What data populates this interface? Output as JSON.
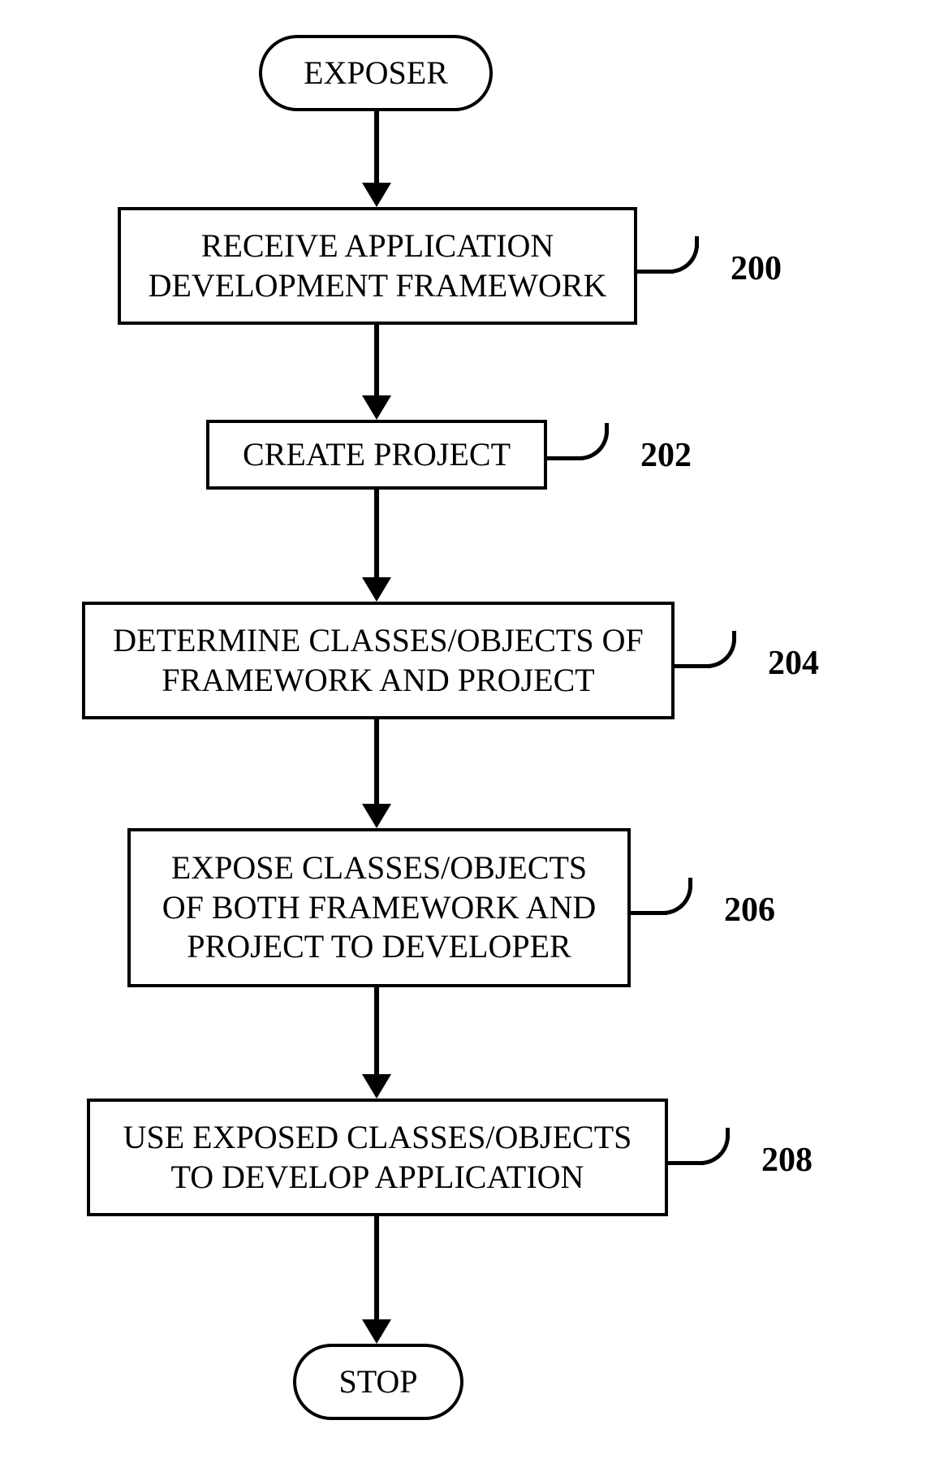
{
  "chart_data": {
    "type": "flowchart",
    "direction": "top-to-bottom",
    "nodes": [
      {
        "id": "start",
        "shape": "terminator",
        "text": "EXPOSER"
      },
      {
        "id": "n200",
        "shape": "process",
        "text": "RECEIVE APPLICATION DEVELOPMENT FRAMEWORK",
        "ref": "200"
      },
      {
        "id": "n202",
        "shape": "process",
        "text": "CREATE PROJECT",
        "ref": "202"
      },
      {
        "id": "n204",
        "shape": "process",
        "text": "DETERMINE CLASSES/OBJECTS OF FRAMEWORK AND PROJECT",
        "ref": "204"
      },
      {
        "id": "n206",
        "shape": "process",
        "text": "EXPOSE CLASSES/OBJECTS OF BOTH FRAMEWORK AND PROJECT TO DEVELOPER",
        "ref": "206"
      },
      {
        "id": "n208",
        "shape": "process",
        "text": "USE EXPOSED CLASSES/OBJECTS TO DEVELOP APPLICATION",
        "ref": "208"
      },
      {
        "id": "stop",
        "shape": "terminator",
        "text": "STOP"
      }
    ],
    "edges": [
      [
        "start",
        "n200"
      ],
      [
        "n200",
        "n202"
      ],
      [
        "n202",
        "n204"
      ],
      [
        "n204",
        "n206"
      ],
      [
        "n206",
        "n208"
      ],
      [
        "n208",
        "stop"
      ]
    ]
  },
  "start": {
    "label": "EXPOSER"
  },
  "stop": {
    "label": "STOP"
  },
  "step200": {
    "line1": "RECEIVE APPLICATION",
    "line2": "DEVELOPMENT FRAMEWORK",
    "ref": "200"
  },
  "step202": {
    "line1": "CREATE PROJECT",
    "ref": "202"
  },
  "step204": {
    "line1": "DETERMINE CLASSES/OBJECTS OF",
    "line2": "FRAMEWORK AND PROJECT",
    "ref": "204"
  },
  "step206": {
    "line1": "EXPOSE CLASSES/OBJECTS",
    "line2": "OF BOTH FRAMEWORK AND",
    "line3": "PROJECT TO DEVELOPER",
    "ref": "206"
  },
  "step208": {
    "line1": "USE EXPOSED CLASSES/OBJECTS",
    "line2": "TO DEVELOP APPLICATION",
    "ref": "208"
  }
}
